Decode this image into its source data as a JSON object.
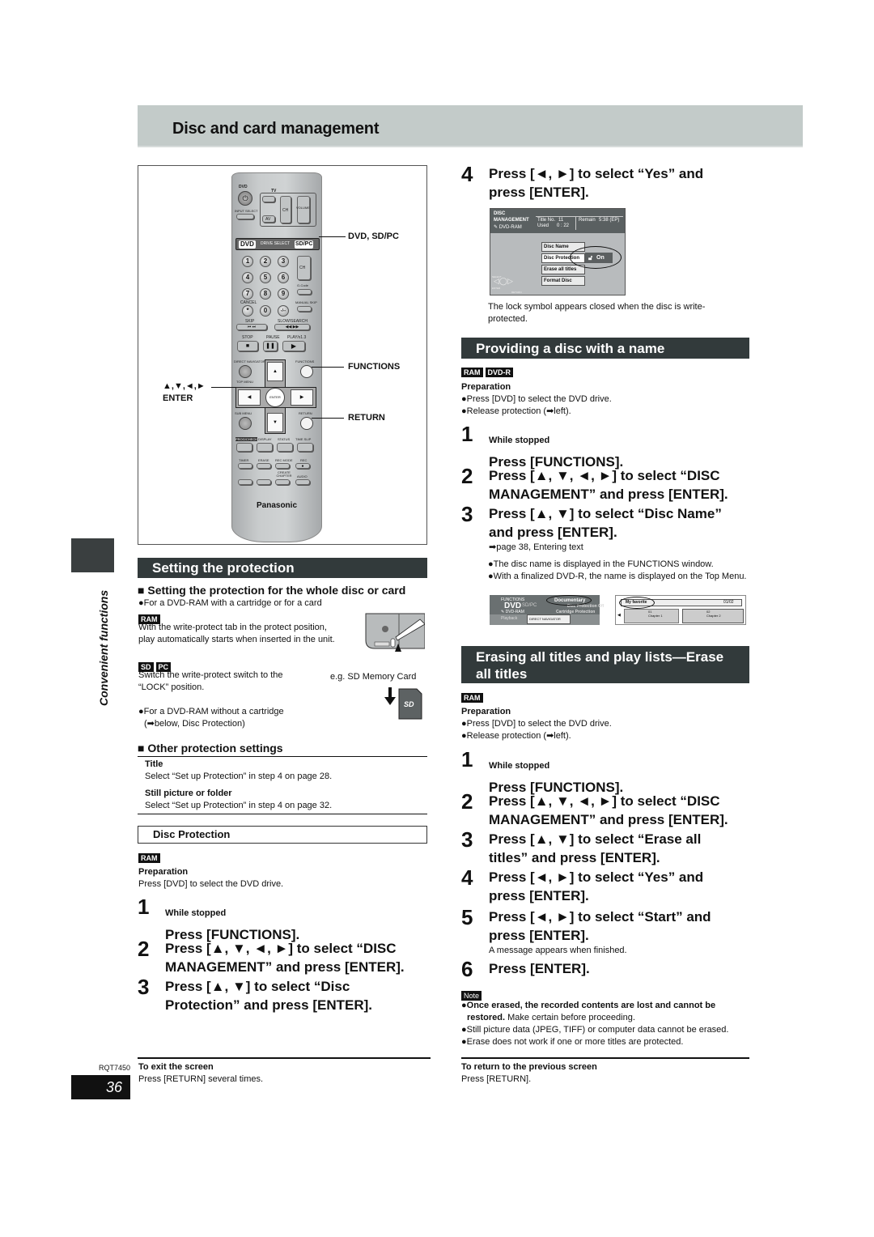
{
  "page": {
    "title": "Disc and card management",
    "side_label": "Convenient functions",
    "page_number": "36",
    "doc_code": "RQT7450"
  },
  "remote": {
    "brand": "Panasonic",
    "labels": {
      "dvd": "DVD",
      "tv": "TV",
      "input_select": "INPUT SELECT",
      "ch": "CH",
      "volume": "VOLUME",
      "av": "AV",
      "drive_dvd": "DVD",
      "drive_select": "DRIVE SELECT",
      "drive_sdpc": "SD/PC",
      "gcode": "G-Code",
      "cancel": "CANCEL",
      "manual_skip": "MANUAL SKIP",
      "skip": "SKIP",
      "slow_search": "SLOW/SEARCH",
      "stop": "STOP",
      "pause": "PAUSE",
      "play": "PLAY/x1.3",
      "direct_navigator": "DIRECT NAVIGATOR",
      "functions": "FUNCTIONS",
      "top_menu": "TOP MENU",
      "enter": "ENTER",
      "sub_menu": "SUB MENU",
      "return": "RETURN",
      "prog_check": "PROG/CHECK",
      "display": "DISPLAY",
      "status": "STATUS",
      "time_slip": "TIME SLIP",
      "timer": "TIMER",
      "erase": "ERASE",
      "rec_mode": "REC MODE",
      "rec": "REC",
      "create_chapter": "CREATE CHAPTER",
      "audio": "AUDIO"
    },
    "digits": [
      "1",
      "2",
      "3",
      "4",
      "5",
      "6",
      "7",
      "8",
      "9",
      "*",
      "0",
      "-/--"
    ],
    "callouts": {
      "drive": "DVD, SD/PC",
      "functions": "FUNCTIONS",
      "arrows": "▲,▼,◄,►",
      "enter": "ENTER",
      "return": "RETURN"
    }
  },
  "setting_protection": {
    "heading": "Setting the protection",
    "whole_disc_heading": "Setting the protection for the whole disc or card",
    "whole_disc_bullet": "●For a DVD-RAM with a cartridge or for a card",
    "ram_badge": "RAM",
    "ram_text_1": "With the write-protect tab in the protect position,",
    "ram_text_2": "play automatically starts when inserted in the unit.",
    "sd_badge": "SD",
    "pc_badge": "PC",
    "sd_text_1": "Switch the write-protect switch to the",
    "sd_text_2": "“LOCK” position.",
    "sd_caption": "e.g. SD Memory Card",
    "no_cartridge_1": "●For a DVD-RAM without a cartridge",
    "no_cartridge_2": "(➡below, Disc Protection)",
    "other_heading": "Other protection settings",
    "other_items": [
      {
        "title": "Title",
        "text": "Select “Set up Protection” in step 4 on page 28."
      },
      {
        "title": "Still picture or folder",
        "text": "Select “Set up Protection” in step 4 on page 32."
      }
    ],
    "disc_protection_heading": "Disc Protection",
    "disc_protection_badge": "RAM",
    "prep_title": "Preparation",
    "prep_text": "Press [DVD] to select the DVD drive.",
    "steps": [
      {
        "num": "1",
        "sub": "While stopped",
        "lines": [
          "Press [FUNCTIONS]."
        ]
      },
      {
        "num": "2",
        "lines": [
          "Press [▲, ▼, ◄, ►] to select “DISC",
          "MANAGEMENT” and press [ENTER]."
        ]
      },
      {
        "num": "3",
        "lines": [
          "Press [▲, ▼] to select “Disc",
          "Protection” and press [ENTER]."
        ]
      }
    ],
    "exit_title": "To exit the screen",
    "exit_text": "Press [RETURN] several times."
  },
  "step4_protection": {
    "num": "4",
    "lines": [
      "Press [◄, ►] to select “Yes” and",
      "press [ENTER]."
    ],
    "osd": {
      "header_1": "DISC",
      "header_2": "MANAGEMENT",
      "header_3": "DVD-RAM",
      "title_no_label": "Title No.",
      "title_no": "11",
      "used_label": "Used",
      "used": "0 : 22",
      "remain_label": "Remain",
      "remain": "5:38 (EP)",
      "menu": [
        "Disc Name",
        "Disc Protection",
        "Erase all titles",
        "Format Disc"
      ],
      "on_label": "On",
      "select_label": "SELECT",
      "enter_label": "ENTER",
      "return_label": "RETURN"
    },
    "caption_1": "The lock symbol appears closed when the disc is write-",
    "caption_2": "protected."
  },
  "disc_name": {
    "heading": "Providing a disc with a name",
    "badges": [
      "RAM",
      "DVD-R"
    ],
    "prep_title": "Preparation",
    "prep_items": [
      "●Press [DVD] to select the DVD drive.",
      "●Release protection (➡left)."
    ],
    "steps": [
      {
        "num": "1",
        "sub": "While stopped",
        "lines": [
          "Press [FUNCTIONS]."
        ]
      },
      {
        "num": "2",
        "lines": [
          "Press [▲, ▼, ◄, ►] to select “DISC",
          "MANAGEMENT” and press [ENTER]."
        ]
      },
      {
        "num": "3",
        "lines": [
          "Press [▲, ▼] to select “Disc Name”",
          "and press [ENTER]."
        ],
        "note": "➡page 38, Entering text"
      }
    ],
    "bullets": [
      "●The disc name is displayed in the FUNCTIONS window.",
      "●With a finalized DVD-R, the name is displayed on the Top Menu."
    ],
    "functions_osd": {
      "label": "FUNCTIONS",
      "dvd": "DVD",
      "sdpc": "SD/PC",
      "media": "DVD-RAM",
      "disc_name": "Documentary",
      "protection_1": "Disc Protection Off",
      "protection_2": "Cartridge Protection",
      "mode": "Playback",
      "button": "DIRECT NAVIGATOR"
    },
    "top_menu_osd": {
      "name": "My favorite",
      "page": "01/02",
      "items": [
        {
          "num": "01",
          "label": "Chapter 1"
        },
        {
          "num": "02",
          "label": "Chapter 2"
        }
      ]
    }
  },
  "erase_all": {
    "heading_1": "Erasing all titles and play lists—Erase",
    "heading_2": "all titles",
    "badge": "RAM",
    "prep_title": "Preparation",
    "prep_items": [
      "●Press [DVD] to select the DVD drive.",
      "●Release protection (➡left)."
    ],
    "steps": [
      {
        "num": "1",
        "sub": "While stopped",
        "lines": [
          "Press [FUNCTIONS]."
        ]
      },
      {
        "num": "2",
        "lines": [
          "Press [▲, ▼, ◄, ►] to select “DISC",
          "MANAGEMENT” and press [ENTER]."
        ]
      },
      {
        "num": "3",
        "lines": [
          "Press [▲, ▼] to select “Erase all",
          "titles” and press [ENTER]."
        ]
      },
      {
        "num": "4",
        "lines": [
          "Press [◄, ►] to select “Yes” and",
          "press [ENTER]."
        ]
      },
      {
        "num": "5",
        "lines": [
          "Press [◄, ►] to select “Start” and",
          "press [ENTER]."
        ],
        "note": "A message appears when finished."
      },
      {
        "num": "6",
        "lines": [
          "Press [ENTER]."
        ]
      }
    ],
    "note_badge": "Note",
    "notes": [
      {
        "bold": "●Once erased, the recorded contents are lost and cannot be",
        "bold2": "restored.",
        "rest": " Make certain before proceeding."
      },
      {
        "text": "●Still picture data (JPEG, TIFF) or computer data cannot be erased."
      },
      {
        "text": "●Erase does not work if one or more titles are protected."
      }
    ],
    "return_title": "To return to the previous screen",
    "return_text": "Press [RETURN]."
  }
}
